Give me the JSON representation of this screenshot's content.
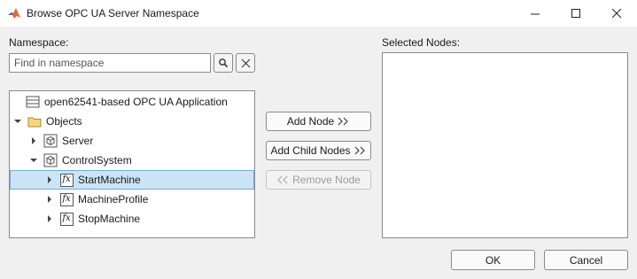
{
  "window": {
    "title": "Browse OPC UA Server Namespace",
    "controls": {
      "minimize": "minimize",
      "maximize": "maximize",
      "close": "close"
    }
  },
  "namespace": {
    "label": "Namespace:",
    "search": {
      "placeholder": "Find in namespace",
      "value": ""
    },
    "search_icon": "search-icon",
    "clear_icon": "close-icon",
    "tree": [
      {
        "label": "open62541-based OPC UA Application",
        "icon": "server-icon",
        "level": 0,
        "expander": "none",
        "selected": false
      },
      {
        "label": "Objects",
        "icon": "folder-icon",
        "level": 0,
        "expander": "expanded",
        "selected": false
      },
      {
        "label": "Server",
        "icon": "object-icon",
        "level": 1,
        "expander": "collapsed",
        "selected": false
      },
      {
        "label": "ControlSystem",
        "icon": "object-icon",
        "level": 1,
        "expander": "expanded",
        "selected": false
      },
      {
        "label": "StartMachine",
        "icon": "method-icon",
        "level": 2,
        "expander": "collapsed",
        "selected": true
      },
      {
        "label": "MachineProfile",
        "icon": "method-icon",
        "level": 2,
        "expander": "collapsed",
        "selected": false
      },
      {
        "label": "StopMachine",
        "icon": "method-icon",
        "level": 2,
        "expander": "collapsed",
        "selected": false
      }
    ],
    "method_glyph": "fx"
  },
  "actions": {
    "add_node": "Add Node",
    "add_child_nodes": "Add Child Nodes",
    "remove_node": "Remove Node",
    "remove_enabled": false
  },
  "selected_nodes": {
    "label": "Selected Nodes:",
    "items": []
  },
  "footer": {
    "ok": "OK",
    "cancel": "Cancel"
  },
  "colors": {
    "selection_bg": "#cce4f7",
    "selection_border": "#7aa7d6",
    "folder_fill": "#f5d77a",
    "matlab_logo": "#e16737"
  }
}
